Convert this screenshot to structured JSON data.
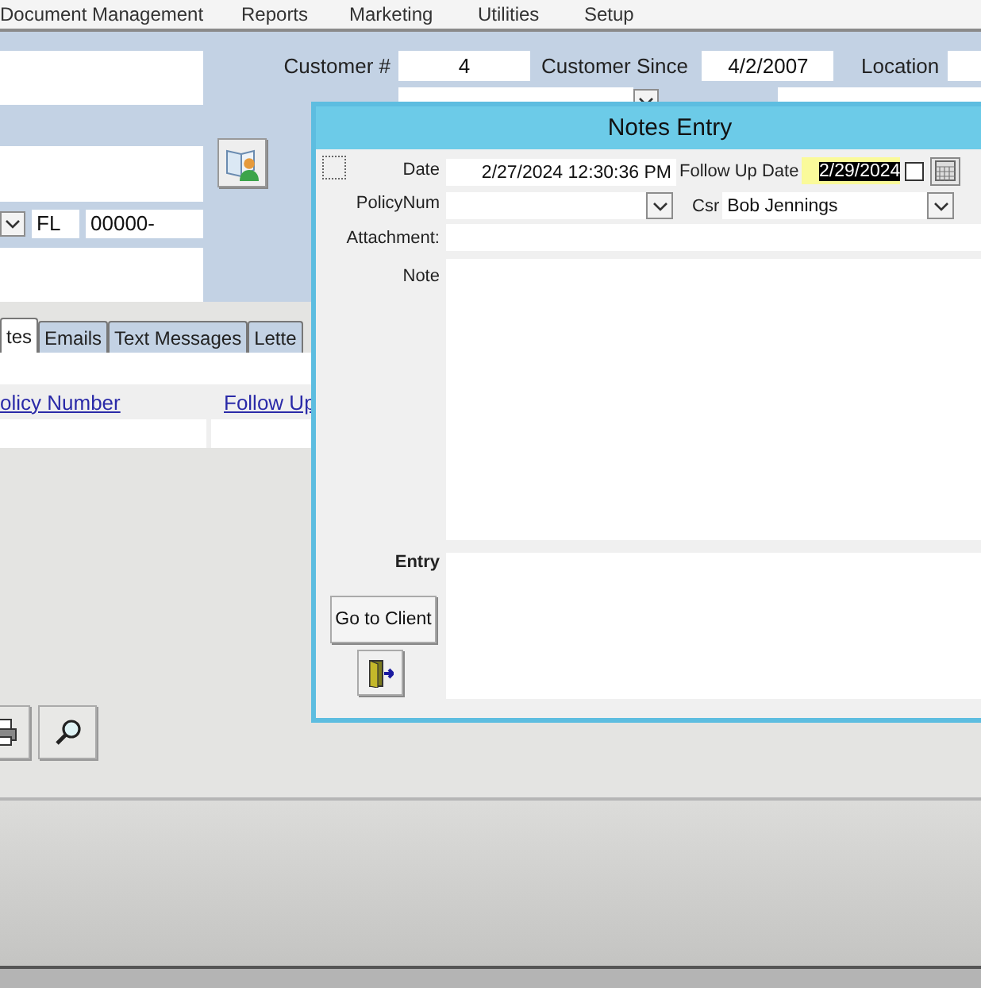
{
  "menu": [
    "Document Management",
    "Reports",
    "Marketing",
    "Utilities",
    "Setup"
  ],
  "customer": {
    "number_label": "Customer #",
    "number": "4",
    "since_label": "Customer Since",
    "since": "4/2/2007",
    "location_label": "Location",
    "state": "FL",
    "zip": "00000-"
  },
  "tabs": [
    {
      "label": "tes",
      "selected": true
    },
    {
      "label": "Emails",
      "selected": false
    },
    {
      "label": "Text Messages",
      "selected": false
    },
    {
      "label": "Lette",
      "selected": false
    }
  ],
  "columns": [
    "olicy Number",
    "Follow Up"
  ],
  "dialog": {
    "title": "Notes Entry",
    "date_label": "Date",
    "date": "2/27/2024 12:30:36 PM",
    "follow_up_label": "Follow Up Date",
    "follow_up_date": "2/29/2024",
    "follow_up_checked": false,
    "policy_label": "PolicyNum",
    "csr_label": "Csr",
    "csr": "Bob Jennings",
    "attachment_label": "Attachment:",
    "note_label": "Note",
    "entry_label": "Entry",
    "go_to_client": "Go to Client"
  }
}
